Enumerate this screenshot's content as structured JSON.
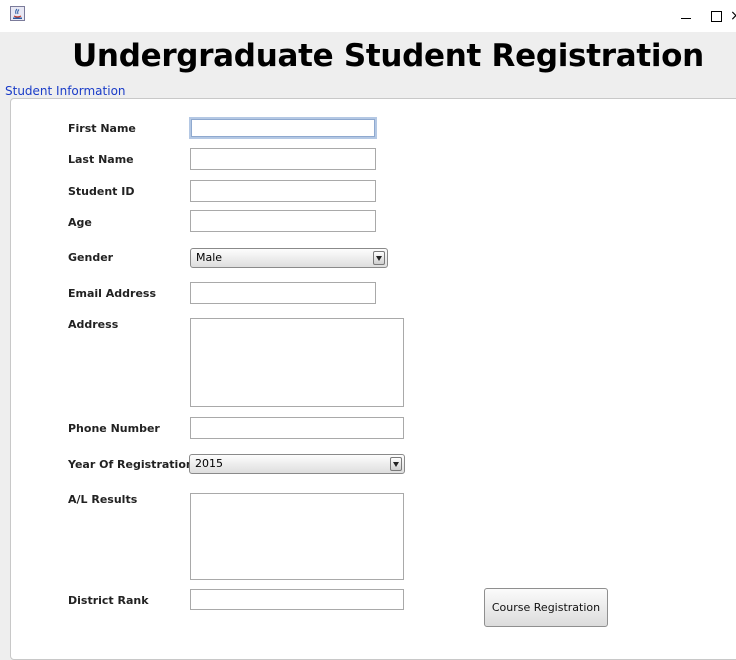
{
  "window": {
    "icon": "java-app-icon",
    "minimize_glyph": "",
    "maximize_glyph": "",
    "close_glyph": "×"
  },
  "header": {
    "title": "Undergraduate Student Registration"
  },
  "panel": {
    "legend": "Student Information"
  },
  "form": {
    "first_name": {
      "label": "First Name",
      "value": ""
    },
    "last_name": {
      "label": "Last Name",
      "value": ""
    },
    "student_id": {
      "label": "Student ID",
      "value": ""
    },
    "age": {
      "label": "Age",
      "value": ""
    },
    "gender": {
      "label": "Gender",
      "selected": "Male"
    },
    "email": {
      "label": "Email Address",
      "value": ""
    },
    "address": {
      "label": "Address",
      "value": ""
    },
    "phone": {
      "label": "Phone Number",
      "value": ""
    },
    "year": {
      "label": "Year Of Registration",
      "selected": "2015"
    },
    "al_results": {
      "label": "A/L Results",
      "value": ""
    },
    "district_rank": {
      "label": "District Rank",
      "value": ""
    }
  },
  "actions": {
    "course_registration": "Course Registration"
  }
}
